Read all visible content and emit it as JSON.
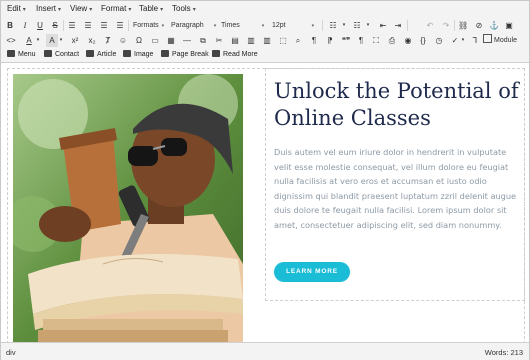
{
  "menubar": {
    "items": [
      {
        "label": "Edit"
      },
      {
        "label": "Insert"
      },
      {
        "label": "View"
      },
      {
        "label": "Format"
      },
      {
        "label": "Table"
      },
      {
        "label": "Tools"
      }
    ]
  },
  "toolbar": {
    "formats_label": "Formats",
    "block_label": "Paragraph",
    "font_label": "Times",
    "size_label": "12pt",
    "bold_glyph": "B",
    "italic_glyph": "I",
    "underline_glyph": "U",
    "strike_glyph": "S",
    "paragraph_glyph": "¶",
    "pilcrow_glyph": "¶",
    "quote_glyph": "❝❞",
    "omega_glyph": "Ω",
    "subscript_glyph": "x₂",
    "superscript_glyph": "x²",
    "row3": [
      {
        "label": "Menu",
        "icon": "menu-icon"
      },
      {
        "label": "Contact",
        "icon": "contact-icon"
      },
      {
        "label": "Article",
        "icon": "article-icon"
      },
      {
        "label": "Image",
        "icon": "image-icon"
      },
      {
        "label": "Page Break",
        "icon": "page-break-icon"
      },
      {
        "label": "Read More",
        "icon": "read-more-icon"
      }
    ],
    "module_label": "Module"
  },
  "content": {
    "heading": "Unlock the Potential of Online Classes",
    "body": "Duis autem vel eum iriure dolor in hendrerit in vulputate velit esse molestie consequat, vel illum dolore eu feugiat nulla facilisis at vero eros et accumsan et iusto odio dignissim qui blandit praesent luptatum zzril delenit augue duis dolore te feugait nulla facilisi. Lorem ipsum dolor sit amet, consectetuer adipiscing elit, sed diam nonummy.",
    "cta_label": "LEARN MORE",
    "image_alt": "photo-student-with-coffee-and-books"
  },
  "statusbar": {
    "path": "div",
    "words": "Words: 213"
  },
  "colors": {
    "heading": "#1f2a4c",
    "body_text": "#8d9aa6",
    "accent": "#1bbcd5",
    "toolbar_bg": "#f3f3f3"
  }
}
